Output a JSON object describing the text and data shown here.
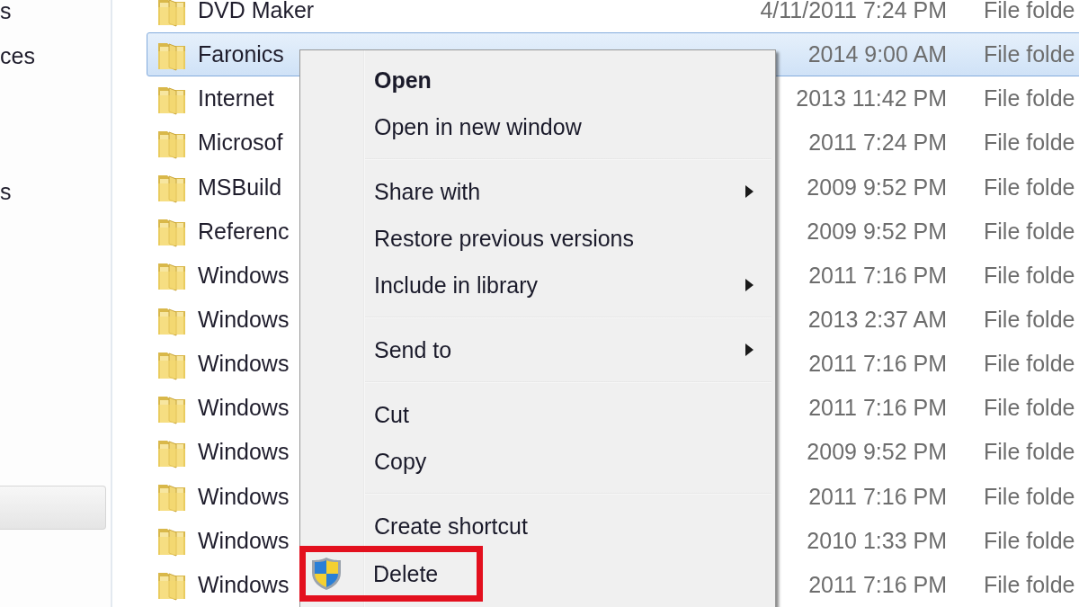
{
  "sidebar": {
    "items": [
      {
        "label": "s"
      },
      {
        "label": "ces"
      },
      {
        "label": "s"
      }
    ]
  },
  "files": [
    {
      "name": "DVD Maker",
      "date": "4/11/2011 7:24 PM",
      "type": "File folde",
      "selected": false
    },
    {
      "name": "Faronics",
      "date": "2014 9:00 AM",
      "type": "File folde",
      "selected": true
    },
    {
      "name": "Internet",
      "date": "2013 11:42 PM",
      "type": "File folde",
      "selected": false
    },
    {
      "name": "Microsof",
      "date": "2011 7:24 PM",
      "type": "File folde",
      "selected": false
    },
    {
      "name": "MSBuild",
      "date": "2009 9:52 PM",
      "type": "File folde",
      "selected": false
    },
    {
      "name": "Referenc",
      "date": "2009 9:52 PM",
      "type": "File folde",
      "selected": false
    },
    {
      "name": "Windows",
      "date": "2011 7:16 PM",
      "type": "File folde",
      "selected": false
    },
    {
      "name": "Windows",
      "date": "2013 2:37 AM",
      "type": "File folde",
      "selected": false
    },
    {
      "name": "Windows",
      "date": "2011 7:16 PM",
      "type": "File folde",
      "selected": false
    },
    {
      "name": "Windows",
      "date": "2011 7:16 PM",
      "type": "File folde",
      "selected": false
    },
    {
      "name": "Windows",
      "date": "2009 9:52 PM",
      "type": "File folde",
      "selected": false
    },
    {
      "name": "Windows",
      "date": "2011 7:16 PM",
      "type": "File folde",
      "selected": false
    },
    {
      "name": "Windows",
      "date": "2010 1:33 PM",
      "type": "File folde",
      "selected": false
    },
    {
      "name": "Windows",
      "date": "2011 7:16 PM",
      "type": "File folde",
      "selected": false
    }
  ],
  "menu": {
    "items": [
      {
        "kind": "item",
        "label": "Open",
        "default": true,
        "submenu": false,
        "shield": false,
        "highlighted": false
      },
      {
        "kind": "item",
        "label": "Open in new window",
        "default": false,
        "submenu": false,
        "shield": false,
        "highlighted": false
      },
      {
        "kind": "separator"
      },
      {
        "kind": "item",
        "label": "Share with",
        "default": false,
        "submenu": true,
        "shield": false,
        "highlighted": false
      },
      {
        "kind": "item",
        "label": "Restore previous versions",
        "default": false,
        "submenu": false,
        "shield": false,
        "highlighted": false
      },
      {
        "kind": "item",
        "label": "Include in library",
        "default": false,
        "submenu": true,
        "shield": false,
        "highlighted": false
      },
      {
        "kind": "separator"
      },
      {
        "kind": "item",
        "label": "Send to",
        "default": false,
        "submenu": true,
        "shield": false,
        "highlighted": false
      },
      {
        "kind": "separator"
      },
      {
        "kind": "item",
        "label": "Cut",
        "default": false,
        "submenu": false,
        "shield": false,
        "highlighted": false
      },
      {
        "kind": "item",
        "label": "Copy",
        "default": false,
        "submenu": false,
        "shield": false,
        "highlighted": false
      },
      {
        "kind": "separator"
      },
      {
        "kind": "item",
        "label": "Create shortcut",
        "default": false,
        "submenu": false,
        "shield": false,
        "highlighted": false
      },
      {
        "kind": "item",
        "label": "Delete",
        "default": false,
        "submenu": false,
        "shield": true,
        "highlighted": true
      }
    ]
  }
}
